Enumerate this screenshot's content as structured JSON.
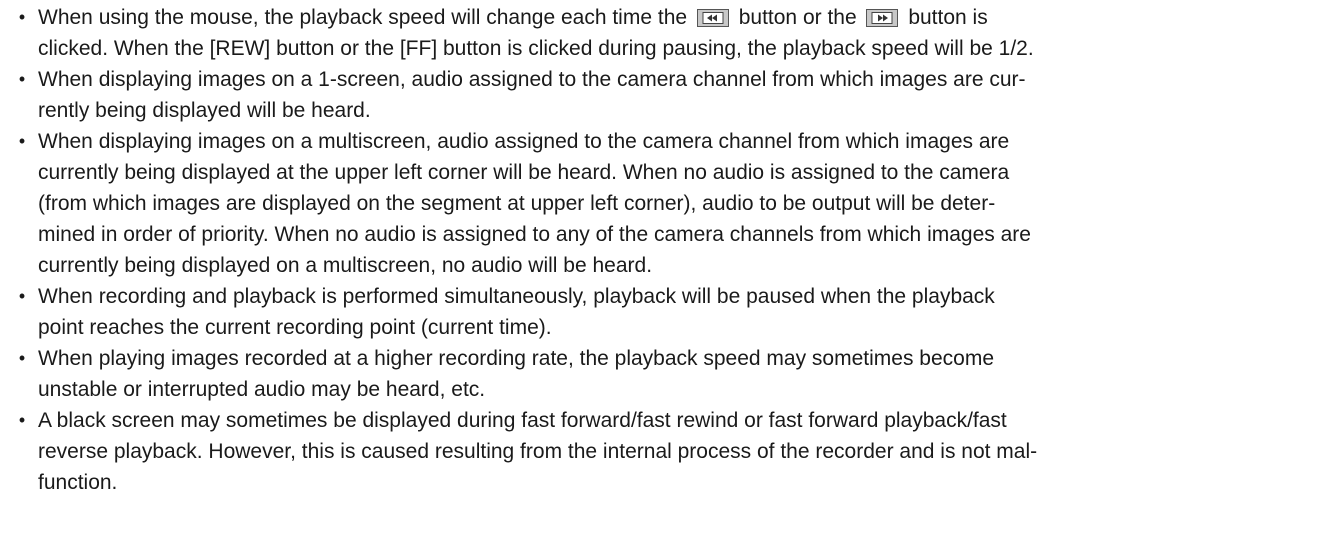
{
  "notes": [
    {
      "lines": [
        [
          "When using the mouse, the playback speed will change each time the ",
          " button or the ",
          " button is"
        ],
        [
          "clicked. When the [REW] button or the [FF] button is clicked during pausing, the playback speed will be 1/2."
        ]
      ],
      "icons": [
        "rewind-button-icon",
        "fast-forward-button-icon"
      ]
    },
    {
      "lines": [
        "When displaying images on a 1-screen, audio assigned to the camera channel from which images are cur-",
        "rently being displayed will be heard."
      ]
    },
    {
      "lines": [
        "When displaying images on a multiscreen, audio assigned to the camera channel from which images are",
        "currently being displayed at the upper left corner will be heard. When no audio is assigned to the camera",
        "(from which images are displayed on the segment at upper left corner), audio to be output will be deter-",
        "mined in order of priority. When no audio is assigned to any of the camera channels from which images are",
        "currently being displayed on a multiscreen, no audio will be heard."
      ]
    },
    {
      "lines": [
        "When recording and playback is performed simultaneously, playback will be paused when the playback",
        "point reaches the current recording point (current time)."
      ]
    },
    {
      "lines": [
        "When playing images recorded at a higher recording rate, the playback speed may sometimes become",
        "unstable or interrupted audio may be heard, etc."
      ]
    },
    {
      "lines": [
        "A black screen may sometimes be displayed during fast forward/fast rewind or fast forward playback/fast",
        "reverse playback. However, this is caused resulting from the internal process of the recorder and is not mal-",
        "function."
      ]
    }
  ],
  "bullet_char": "•",
  "colors": {
    "text": "#1a1a1a",
    "icon_fill": "#c8c8c8",
    "icon_glyph": "#333333"
  }
}
